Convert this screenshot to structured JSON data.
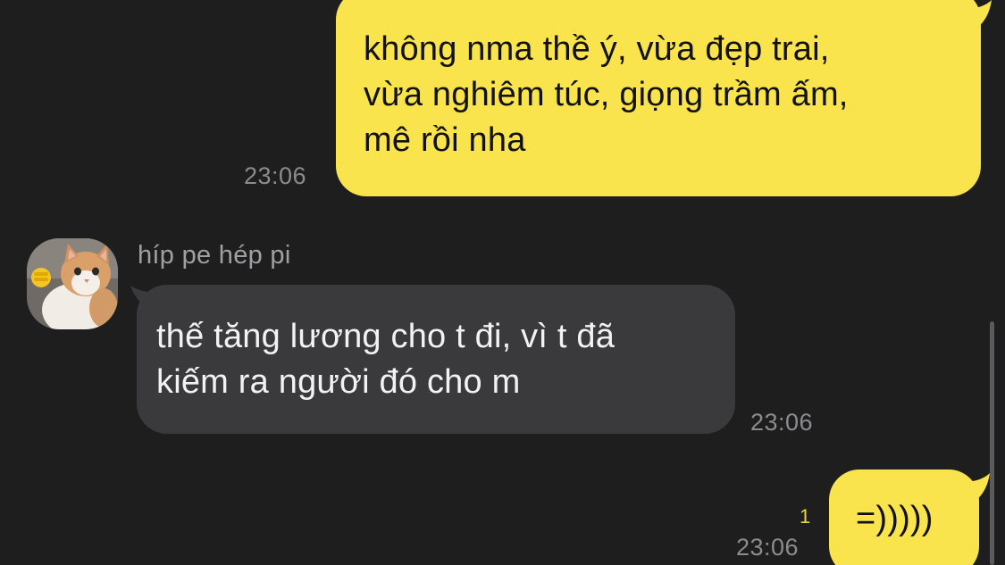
{
  "messages": [
    {
      "direction": "out",
      "lines": [
        "không nma thề ý, vừa đẹp trai,",
        "vừa nghiêm túc, giọng trầm ấm,",
        "mê rồi nha"
      ],
      "time": "23:06"
    },
    {
      "direction": "in",
      "sender": "híp pe hép pi",
      "avatar_icon": "cat-avatar-icon",
      "lines": [
        "thế tăng lương cho t đi, vì t đã",
        "kiếm ra người đó cho m"
      ],
      "time": "23:06"
    },
    {
      "direction": "out",
      "lines": [
        "=)))))"
      ],
      "time": "23:06",
      "unread_count": "1"
    }
  ],
  "colors": {
    "background": "#1e1e1f",
    "outgoing_bubble": "#f9e44d",
    "incoming_bubble": "#3a3a3c",
    "timestamp": "#8c8c8f",
    "unread": "#f0d43a"
  }
}
